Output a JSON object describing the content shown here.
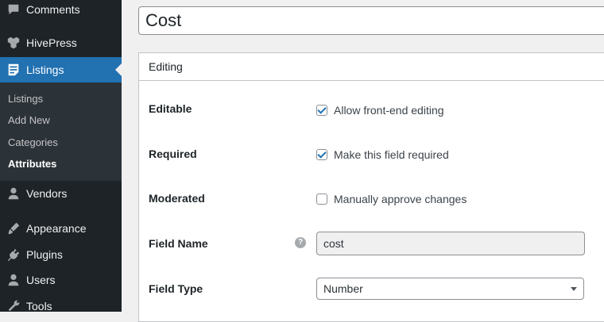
{
  "sidebar": {
    "items": [
      {
        "label": "Comments",
        "icon": "comments-icon"
      },
      {
        "label": "HivePress",
        "icon": "hivepress-icon"
      },
      {
        "label": "Listings",
        "icon": "listings-icon"
      },
      {
        "label": "Vendors",
        "icon": "vendors-icon"
      },
      {
        "label": "Appearance",
        "icon": "appearance-icon"
      },
      {
        "label": "Plugins",
        "icon": "plugins-icon"
      },
      {
        "label": "Users",
        "icon": "users-icon"
      },
      {
        "label": "Tools",
        "icon": "tools-icon"
      }
    ],
    "submenu": [
      {
        "label": "Listings"
      },
      {
        "label": "Add New"
      },
      {
        "label": "Categories"
      },
      {
        "label": "Attributes"
      }
    ]
  },
  "title": {
    "value": "Cost"
  },
  "editing": {
    "header": "Editing",
    "editable": {
      "label": "Editable",
      "option": "Allow front-end editing",
      "checked": true
    },
    "required": {
      "label": "Required",
      "option": "Make this field required",
      "checked": true
    },
    "moderated": {
      "label": "Moderated",
      "option": "Manually approve changes",
      "checked": false
    },
    "field_name": {
      "label": "Field Name",
      "value": "cost",
      "help": "?"
    },
    "field_type": {
      "label": "Field Type",
      "value": "Number"
    }
  },
  "colors": {
    "accent": "#2271b1",
    "sidebar": "#1d2327",
    "submenu": "#2c3338"
  }
}
